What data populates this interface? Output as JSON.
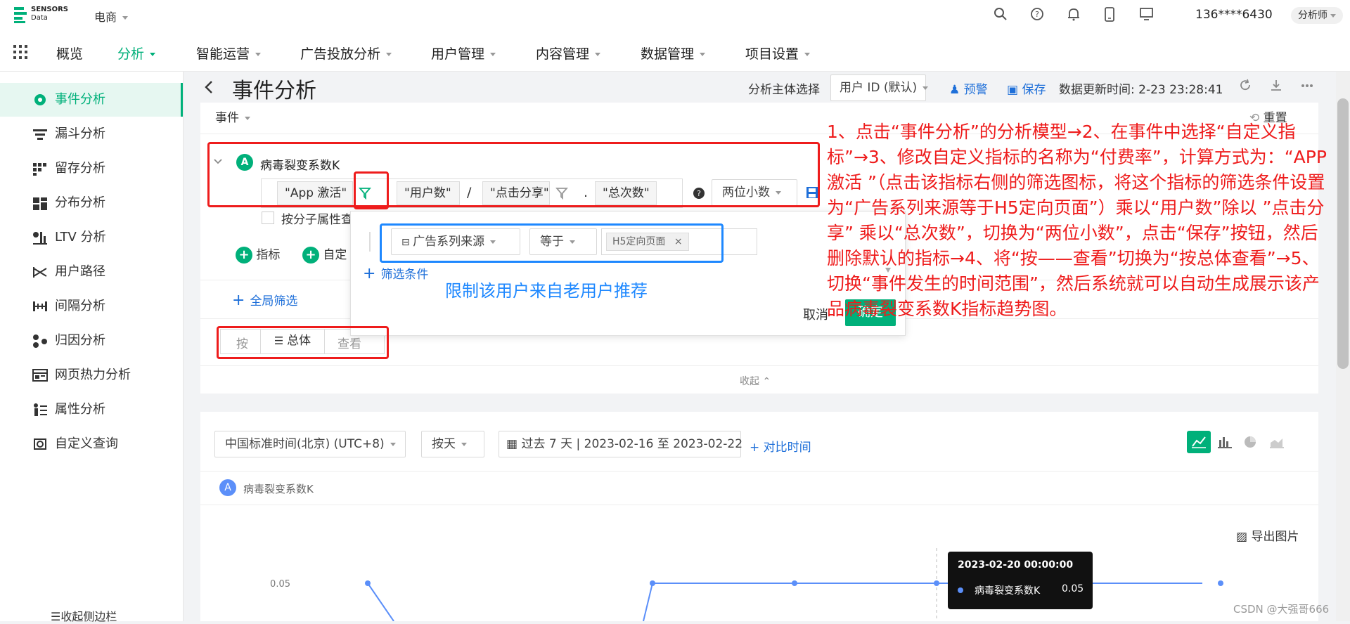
{
  "brand": {
    "logo_line1": "SENSORS",
    "logo_line2": "Data",
    "project": "电商"
  },
  "user": {
    "phone": "136****6430",
    "role": "分析师"
  },
  "nav": {
    "overview": "概览",
    "analysis": "分析",
    "ops": "智能运营",
    "ads": "广告投放分析",
    "users": "用户管理",
    "content": "内容管理",
    "data": "数据管理",
    "settings": "项目设置"
  },
  "sidebar": {
    "items": [
      "事件分析",
      "漏斗分析",
      "留存分析",
      "分布分析",
      "LTV 分析",
      "用户路径",
      "间隔分析",
      "归因分析",
      "网页热力分析",
      "属性分析",
      "自定义查询"
    ],
    "collapse": "收起侧边栏"
  },
  "header": {
    "title": "事件分析",
    "subject_label": "分析主体选择",
    "subject_value": "用户 ID (默认)",
    "alert": "预警",
    "save": "保存",
    "updated": "数据更新时间: 2-23 23:28:41"
  },
  "builder": {
    "events_label": "事件",
    "reset": "重置",
    "metric_badge": "A",
    "metric_name": "病毒裂变系数K",
    "f_app": "\"App 激活\"",
    "f_users": "\"用户数\"",
    "f_div": "/",
    "f_click": "\"点击分享\"",
    "f_dot": ".",
    "f_total": "\"总次数\"",
    "decimal": "两位小数",
    "by_sub_attr": "按分子属性查",
    "add_metric": "指标",
    "add_custom": "自定",
    "global_filter": "全局筛选",
    "by": "按",
    "overall": "总体",
    "view": "查看",
    "collapse": "收起"
  },
  "popover": {
    "prop": "广告系列来源",
    "op": "等于",
    "value": "H5定向页面",
    "add_filter": "筛选条件",
    "note": "限制该用户来自老用户推荐",
    "cancel": "取消",
    "confirm": "确定"
  },
  "controls": {
    "tz": "中国标准时间(北京) (UTC+8)",
    "gran": "按天",
    "range": "过去 7 天 | 2023-02-16 至 2023-02-22",
    "compare": "对比时间"
  },
  "chart_head": {
    "badge": "A",
    "series": "病毒裂变系数K",
    "export": "导出图片"
  },
  "tooltip": {
    "date": "2023-02-20 00:00:00",
    "series": "病毒裂变系数K",
    "value": "0.05"
  },
  "annotation": "1、点击“事件分析”的分析模型→2、在事件中选择“自定义指标”→3、修改自定义指标的名称为“付费率”，计算方式为：“APP激活 ”（点击该指标右侧的筛选图标，将这个指标的筛选条件设置为“广告系列来源等于H5定向页面”）乘以“用户数”除以 ”点击分享” 乘以“总次数”，切换为“两位小数”，点击“保存”按钮，然后删除默认的指标→4、将“按——查看”切换为“按总体查看”→5、切换“事件发生的时间范围”，然后系统就可以自动生成展示该产品病毒裂变系数K指标趋势图。",
  "watermark": "CSDN @大强哥666",
  "colors": {
    "brand_green": "#00b07a",
    "annotation_red": "#ee1c1c",
    "highlight_blue": "#1e88ff",
    "line_blue": "#5b8ff9"
  },
  "chart_data": {
    "type": "line",
    "series": [
      {
        "name": "病毒裂变系数K",
        "values": [
          0.05,
          null,
          0.05,
          0.05,
          0.05,
          0.05,
          0.05
        ]
      }
    ],
    "y_ticks": [
      "0.05"
    ],
    "note": "partial chart visible; dips below 0.05 between first and third points"
  }
}
